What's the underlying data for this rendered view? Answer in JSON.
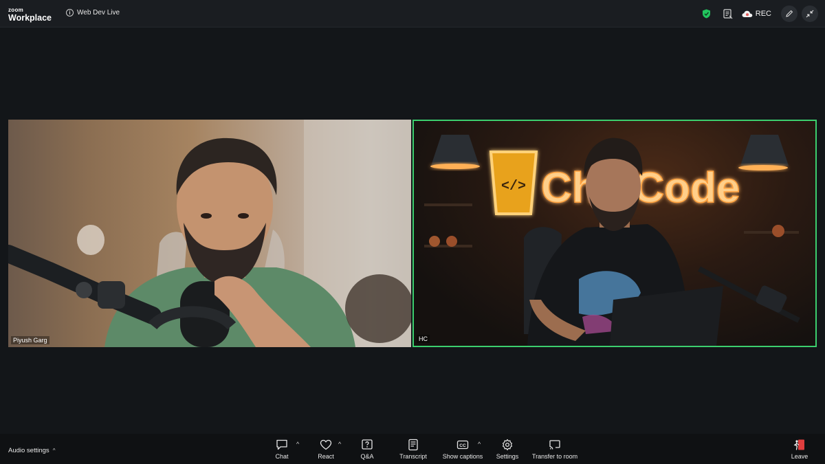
{
  "app": {
    "logo_top": "zoom",
    "logo_bottom": "Workplace"
  },
  "meeting": {
    "title": "Web Dev Live"
  },
  "top_right": {
    "rec_label": "REC"
  },
  "participants": [
    {
      "name": "Piyush Garg",
      "active_speaker": false
    },
    {
      "name": "HC",
      "active_speaker": true
    }
  ],
  "background_sign": {
    "text": "ChaiCode"
  },
  "bottom_bar": {
    "audio_settings_label": "Audio settings",
    "buttons": {
      "chat": "Chat",
      "react": "React",
      "qa": "Q&A",
      "transcript": "Transcript",
      "captions": "Show captions",
      "settings": "Settings",
      "transfer": "Transfer to room",
      "leave": "Leave"
    }
  },
  "colors": {
    "active_speaker_border": "#3ccf6e",
    "shield": "#22c55e",
    "rec_dot": "#e25c5c",
    "leave": "#e03e3e"
  }
}
